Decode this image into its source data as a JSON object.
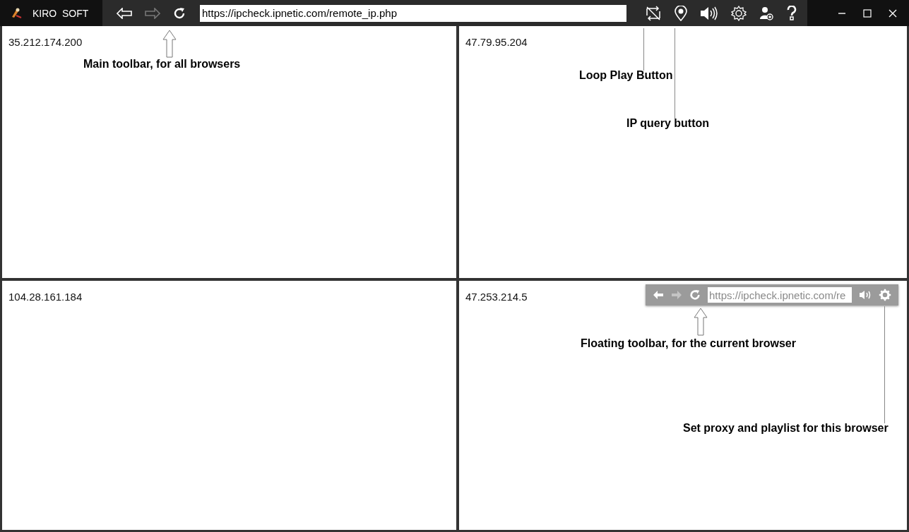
{
  "window": {
    "title": "KIRO  SOFT"
  },
  "main_toolbar": {
    "back_disabled": false,
    "forward_disabled": true,
    "url": "https://ipcheck.ipnetic.com/remote_ip.php"
  },
  "panes": [
    {
      "ip": "35.212.174.200"
    },
    {
      "ip": "47.79.95.204"
    },
    {
      "ip": "104.28.161.184"
    },
    {
      "ip": "47.253.214.5",
      "floating_toolbar": {
        "back_disabled": false,
        "forward_disabled": true,
        "url": "https://ipcheck.ipnetic.com/re"
      }
    }
  ],
  "annotations": [
    {
      "kind": "arrow",
      "text": "Main toolbar, for all browsers"
    },
    {
      "kind": "line",
      "text": "Loop Play Button"
    },
    {
      "kind": "line",
      "text": "IP query button"
    },
    {
      "kind": "arrow",
      "text": "Floating toolbar, for the current browser"
    },
    {
      "kind": "line",
      "text": "Set proxy and playlist for this browser"
    }
  ]
}
